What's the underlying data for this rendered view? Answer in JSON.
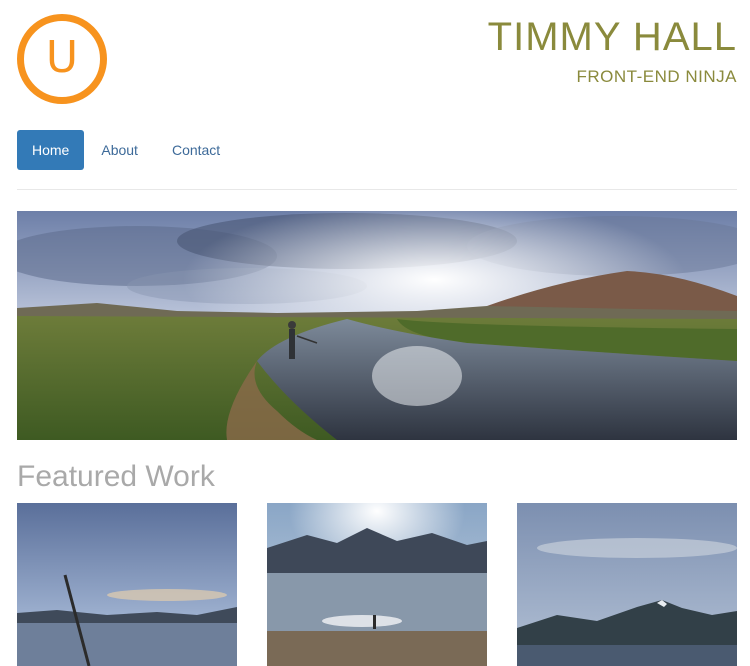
{
  "header": {
    "logo_letter": "U",
    "name": "TIMMY HALL",
    "tagline": "FRONT-END NINJA"
  },
  "nav": {
    "items": [
      {
        "label": "Home",
        "active": true
      },
      {
        "label": "About",
        "active": false
      },
      {
        "label": "Contact",
        "active": false
      }
    ]
  },
  "hero": {
    "image": "panoramic-river-landscape"
  },
  "featured": {
    "title": "Featured Work",
    "items": [
      {
        "image": "lake-with-fishing-rod"
      },
      {
        "image": "mountain-lake-with-person"
      },
      {
        "image": "snowy-mountain-lake"
      }
    ]
  },
  "colors": {
    "accent_orange": "#f7931e",
    "brand_olive": "#8a8a3c",
    "nav_active": "#337ab7",
    "nav_link": "#3d6a99",
    "heading_gray": "#a9a9a9"
  }
}
